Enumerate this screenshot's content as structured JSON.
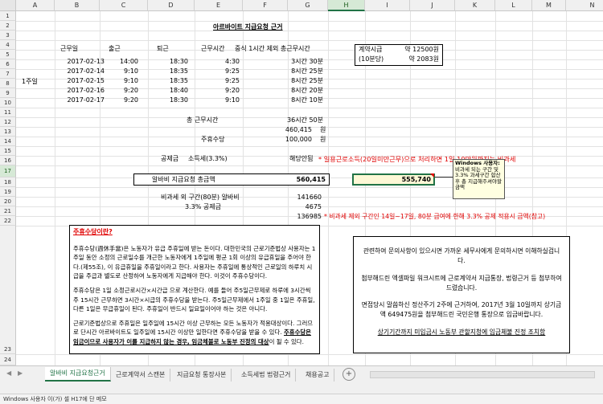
{
  "columns": [
    "A",
    "B",
    "C",
    "D",
    "E",
    "F",
    "G",
    "H",
    "I",
    "J",
    "K",
    "L",
    "M",
    "N"
  ],
  "rows": [
    "1",
    "2",
    "3",
    "4",
    "5",
    "6",
    "7",
    "8",
    "9",
    "10",
    "11",
    "12",
    "13",
    "14",
    "15",
    "16",
    "17",
    "18",
    "19",
    "20",
    "21",
    "22",
    "23",
    "24"
  ],
  "sheet": {
    "title": "아르바이트 지급요청 근거",
    "headers": {
      "date": "근무일",
      "in": "출근",
      "out": "퇴근",
      "hours": "근무시간",
      "net": "중식 1시간 제외 총근무시간"
    },
    "week_label": "1주일",
    "entries": [
      {
        "date": "2017-02-13",
        "in": "14:00",
        "out": "18:30",
        "hours": "4:30",
        "net": "3시간 30분"
      },
      {
        "date": "2017-02-14",
        "in": "9:10",
        "out": "18:35",
        "hours": "9:25",
        "net": "8시간 25분"
      },
      {
        "date": "2017-02-15",
        "in": "9:10",
        "out": "18:35",
        "hours": "9:25",
        "net": "8시간 25분"
      },
      {
        "date": "2017-02-16",
        "in": "9:20",
        "out": "18:40",
        "hours": "9:20",
        "net": "8시간 20분"
      },
      {
        "date": "2017-02-17",
        "in": "9:20",
        "out": "18:30",
        "hours": "9:10",
        "net": "8시간 10분"
      }
    ],
    "wage_box": {
      "label1": "계약시급",
      "label2": "(10분당)",
      "value1": "약 12500원",
      "value2": "약 2083원"
    },
    "total_time_label": "총 근무시간",
    "total_time_value": "36시간 50분",
    "total_pay": "460,415",
    "won": "원",
    "weekly_allowance_label": "주휴수당",
    "weekly_allowance_value": "100,000",
    "deduction_label": "공제금",
    "tax_label": "소득세(3.3%)",
    "not_applicable": "해당안됨",
    "tax_note": "* 일용근로소득(20일미만근무)으로 처리하면 1일 10만원까지는 비과세",
    "request_label": "알바비 지급요청 총금액",
    "request_value": "560,415",
    "alt_value": "555,740",
    "nontax_label": "비과세 외 구간(80분) 알바비",
    "nontax_value": "141660",
    "deduct33_label": "3.3% 공제금",
    "deduct33_value": "4675",
    "row21_value": "136985",
    "row21_note": "* 비과세 제외 구간인 14일~17일, 80분 급여에 한해 3.3% 공제 적용시 금액(참고)",
    "comment": {
      "author": "Windows 사용자:",
      "text": "비과세 되는 구간 및 3.3% 과세구간 합산 후 총 지급해주셔야할 금액"
    },
    "left_box": {
      "title": "주휴수당이란?",
      "p1": "주휴수당(週休手當)은 노동자가 유급 주휴일에 받는 돈이다. 대한민국의 근로기준법상 사용자는 1주일 동안 소정의 근로일수를 개근한 노동자에게 1주일에 평균 1회 이상의 유급휴일을 주어야 한다.(제55조), 이 유급휴일을 주휴일이라고 한다. 사용자는 주휴일에 통상적인 근로일의 하루치 시급을 주급과 별도로 산정하여 노동자에게 지급해야 한다. 이것이 주휴수당이다.",
      "p2": "주휴수당은 1일 소정근로시간×시간급 으로 계산한다. 예를 들어 주5일근무제로 하루에 3시간씩 주 15시간 근무하면 3시간×시급의 주휴수당을 받는다. 주5일근무제에서 1주일 중 1일은 주휴일, 다른 1일은 무급휴일이 된다. 주휴일이 반드시 일요일이어야 하는 것은 아니다.",
      "p3a": "근로기준법상으로 주휴일은 일주일에 15시간 이상 근무하는 모든 노동자가 적용대상이다. 그러므로 단시간 아르바이트도 일주일에 15시간 이상만 일한다면 주휴수당을 받을 수 있다. ",
      "p3b": "주휴수당은 임금이므로 사용자가 이를 지급하지 않는 경우, 임금체불로 노동부 진정의 대상",
      "p3c": "이 될 수 있다."
    },
    "right_box": {
      "p1": "관련하여 문의사항이 있으시면 가까운 세무사에게 문의하시면 이해하실겁니다.",
      "p2": "첨부해드린 엑셀파일 워크시트에 근로계약서 지급통장, 법령근거 등 첨부하여 드렸습니다.",
      "p3": "면접당시 말씀하신 정산주기 2주에 근거하여, 2017년 3월 10일까지 상기금액 649475원을 첨부해드린 국민은행 통장으로 입금바랍니다.",
      "p4": "상기기간까지 미입금시 노동부 관할지청에 임금체불 진정 조치함"
    }
  },
  "tabs": [
    "알바비 지급요청근거",
    "근로계약서 스캔본",
    "지급요청 통장사본",
    "소득세법 법령근거",
    "채용공고"
  ],
  "add_sheet": "+",
  "status": "Windows 사용자 이(가) 셀 H17에 단 메모"
}
